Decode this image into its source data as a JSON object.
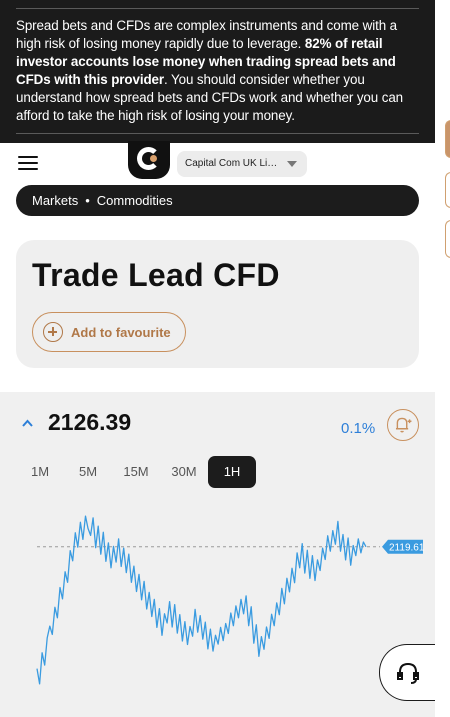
{
  "risk_warning": {
    "text_before": "Spread bets and CFDs are complex instruments and come with a high risk of losing money rapidly due to leverage. ",
    "text_bold": "82% of retail investor accounts lose money when trading spread bets and CFDs with this provider",
    "text_after": ". You should consider whether you understand how spread bets and CFDs work and whether you can afford to take the high risk of losing your money."
  },
  "header": {
    "entity_select": "Capital Com UK Lim…",
    "menu_icon": "hamburger-menu-icon",
    "logo": "capital-com-logo"
  },
  "breadcrumb": {
    "items": [
      "Markets",
      "Commodities"
    ],
    "separator": "•"
  },
  "instrument": {
    "title": "Trade Lead CFD",
    "favourite_label": "Add to favourite"
  },
  "quote": {
    "price": "2126.39",
    "change": "0.1%",
    "current_marker": "2119.61"
  },
  "timeframes": {
    "options": [
      "1M",
      "5M",
      "15M",
      "30M",
      "1H"
    ],
    "selected": "1H"
  },
  "colors": {
    "accent": "#c8905e",
    "line": "#3a9be0",
    "change_text": "#2d7fd8",
    "dark": "#1c1c1c"
  },
  "chart_data": {
    "type": "line",
    "current_value": 2119.61,
    "y_axis_labels": [],
    "series": [
      {
        "values": [
          2091.8,
          2088.3,
          2095.4,
          2092.6,
          2098.8,
          2101.5,
          2099.6,
          2105.8,
          2103.4,
          2110.3,
          2107.7,
          2113.9,
          2111.5,
          2118.7,
          2116.4,
          2122.8,
          2119.5,
          2125.2,
          2121.3,
          2126.6,
          2123.8,
          2122.2,
          2126.2,
          2119.4,
          2124.3,
          2117.9,
          2122.9,
          2116.3,
          2120.5,
          2114.8,
          2119.7,
          2116.1,
          2121.4,
          2115.1,
          2119.3,
          2113.7,
          2117.9,
          2111.5,
          2115.2,
          2109.4,
          2113.3,
          2107.5,
          2111.7,
          2105.4,
          2109.2,
          2103.7,
          2107.6,
          2101.2,
          2105.5,
          2099.4,
          2104.3,
          2102.2,
          2107.1,
          2101.3,
          2106.4,
          2099.9,
          2104.1,
          2098.1,
          2102.5,
          2097.3,
          2101.4,
          2099.2,
          2105.3,
          2100.1,
          2103.9,
          2098.5,
          2102.4,
          2096.3,
          2100.8,
          2095.8,
          2099.4,
          2097.4,
          2101.2,
          2098.2,
          2102.1,
          2099.8,
          2104.5,
          2101.6,
          2106.1,
          2103.4,
          2107.6,
          2104.3,
          2108.4,
          2101.6,
          2105.9,
          2097.6,
          2101.8,
          2094.6,
          2099.1,
          2096.2,
          2101.3,
          2098.7,
          2104.2,
          2101.6,
          2106.8,
          2104.1,
          2110.1,
          2106.6,
          2112.4,
          2109.3,
          2114.7,
          2111.4,
          2118.2,
          2114.8,
          2120.3,
          2113.6,
          2118.8,
          2112.4,
          2117.6,
          2111.9,
          2116.6,
          2114.2,
          2119.3,
          2116.7,
          2122.1,
          2118.6,
          2123.3,
          2120.2,
          2125.4,
          2118.6,
          2122.4,
          2116.6,
          2121.6,
          2115.4,
          2119.9,
          2117.6,
          2121.4,
          2118.2,
          2120.7,
          2119.6
        ]
      }
    ]
  }
}
